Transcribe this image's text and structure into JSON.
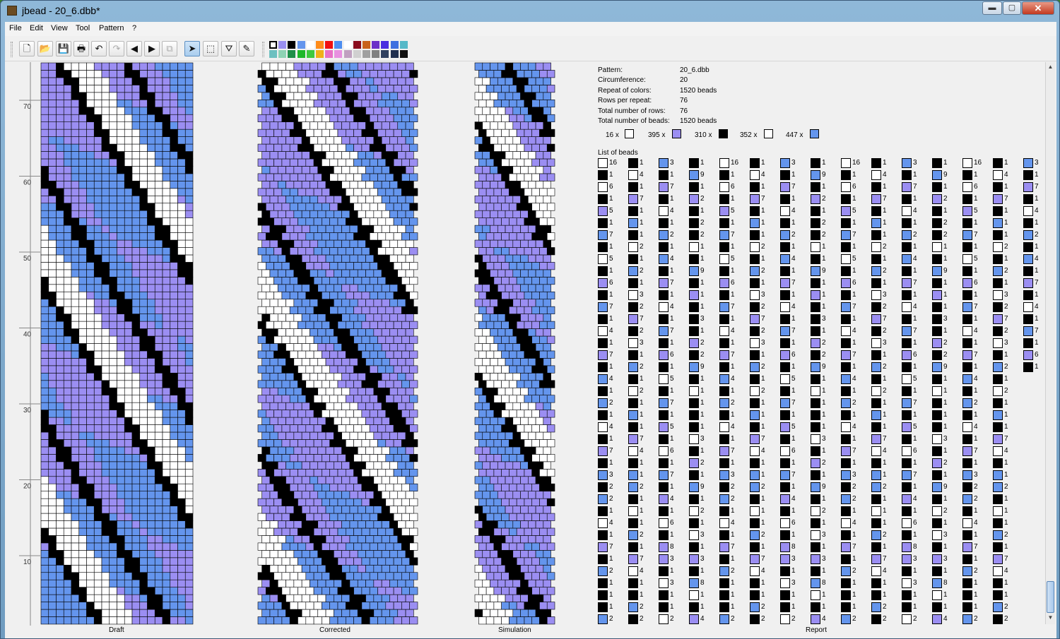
{
  "window": {
    "title": "jbead - 20_6.dbb*",
    "minimize": "▬",
    "maximize": "▢",
    "close": "✕"
  },
  "menu": [
    "File",
    "Edit",
    "View",
    "Tool",
    "Pattern",
    "?"
  ],
  "toolbar": [
    {
      "name": "new-icon",
      "glyph": "🗋"
    },
    {
      "name": "open-icon",
      "glyph": "📂"
    },
    {
      "name": "save-icon",
      "glyph": "💾"
    },
    {
      "name": "print-icon",
      "glyph": "🖶"
    },
    {
      "name": "undo-icon",
      "glyph": "↶"
    },
    {
      "name": "redo-icon",
      "glyph": "↷"
    },
    {
      "name": "shift-left-icon",
      "glyph": "◀"
    },
    {
      "name": "shift-right-icon",
      "glyph": "▶"
    },
    {
      "name": "copy-icon",
      "glyph": "⧉"
    },
    {
      "name": "pointer-tool-icon",
      "glyph": "➤"
    },
    {
      "name": "select-tool-icon",
      "glyph": "⬚"
    },
    {
      "name": "fill-tool-icon",
      "glyph": "⛛"
    },
    {
      "name": "picker-tool-icon",
      "glyph": "✎"
    }
  ],
  "palette": [
    "#ffffff",
    "#9a8ff0",
    "#000000",
    "#6495ed",
    "#ffffff",
    "#ff8c1a",
    "#f01010",
    "#4e8ef0",
    "#ffffff",
    "#8a0d1e",
    "#c8621c",
    "#6b2fc8",
    "#4a2ce0",
    "#3e6fe0",
    "#55b8c8",
    "#6dc0c0",
    "#8ed3b4",
    "#1f8f49",
    "#1fb82a",
    "#3fc93f",
    "#f0b01a",
    "#e870c8",
    "#e890e0",
    "#c0a0c0",
    "#d0d0d0",
    "#a0a0a0",
    "#808080",
    "#304060",
    "#203050",
    "#101010"
  ],
  "colors": {
    "white": "#ffffff",
    "lavender": "#9b8ef2",
    "black": "#000000",
    "blue": "#6495ed"
  },
  "ruler": [
    "70",
    "60",
    "50",
    "40",
    "30",
    "20",
    "10"
  ],
  "labels": {
    "draft": "Draft",
    "corrected": "Corrected",
    "simulation": "Simulation",
    "report": "Report"
  },
  "report": {
    "rows": [
      [
        "Pattern:",
        "20_6.dbb"
      ],
      [
        "Circumference:",
        "20"
      ],
      [
        "Repeat of colors:",
        "1520 beads"
      ],
      [
        "Rows per repeat:",
        "76"
      ],
      [
        "Total number of rows:",
        "76"
      ],
      [
        "Total number of beads:",
        "1520 beads"
      ]
    ],
    "counts": [
      {
        "n": "16 x",
        "c": "white"
      },
      {
        "n": "395 x",
        "c": "lavender"
      },
      {
        "n": "310 x",
        "c": "black"
      },
      {
        "n": "352 x",
        "c": "white"
      },
      {
        "n": "447 x",
        "c": "blue"
      }
    ],
    "list_title": "List of beads"
  },
  "bead_list": [
    [
      [
        "white",
        "16"
      ],
      [
        "black",
        "1"
      ],
      [
        "white",
        "6"
      ],
      [
        "black",
        "1"
      ],
      [
        "lavender",
        "5"
      ],
      [
        "black",
        "1"
      ],
      [
        "blue",
        "7"
      ],
      [
        "black",
        "1"
      ],
      [
        "white",
        "5"
      ],
      [
        "black",
        "1"
      ],
      [
        "lavender",
        "6"
      ],
      [
        "black",
        "1"
      ],
      [
        "blue",
        "7"
      ],
      [
        "black",
        "1"
      ],
      [
        "white",
        "4"
      ],
      [
        "black",
        "1"
      ],
      [
        "lavender",
        "7"
      ],
      [
        "black",
        "1"
      ],
      [
        "blue",
        "4"
      ],
      [
        "black",
        "1"
      ],
      [
        "blue",
        "2"
      ],
      [
        "black",
        "1"
      ],
      [
        "white",
        "4"
      ],
      [
        "black",
        "1"
      ],
      [
        "lavender",
        "7"
      ],
      [
        "black",
        "1"
      ],
      [
        "blue",
        "3"
      ],
      [
        "black",
        "2"
      ],
      [
        "blue",
        "2"
      ],
      [
        "black",
        "1"
      ],
      [
        "white",
        "4"
      ],
      [
        "black",
        "1"
      ],
      [
        "lavender",
        "7"
      ],
      [
        "black",
        "1"
      ],
      [
        "blue",
        "2"
      ],
      [
        "black",
        "1"
      ],
      [
        "black",
        "1"
      ],
      [
        "black",
        "1"
      ],
      [
        "blue",
        "2"
      ]
    ],
    [
      [
        "black",
        "1"
      ],
      [
        "white",
        "4"
      ],
      [
        "black",
        "1"
      ],
      [
        "lavender",
        "7"
      ],
      [
        "black",
        "1"
      ],
      [
        "blue",
        "1"
      ],
      [
        "black",
        "1"
      ],
      [
        "white",
        "2"
      ],
      [
        "black",
        "1"
      ],
      [
        "blue",
        "2"
      ],
      [
        "black",
        "1"
      ],
      [
        "white",
        "3"
      ],
      [
        "black",
        "2"
      ],
      [
        "lavender",
        "7"
      ],
      [
        "black",
        "2"
      ],
      [
        "white",
        "3"
      ],
      [
        "black",
        "1"
      ],
      [
        "blue",
        "2"
      ],
      [
        "black",
        "1"
      ],
      [
        "white",
        "2"
      ],
      [
        "black",
        "1"
      ],
      [
        "blue",
        "1"
      ],
      [
        "black",
        "1"
      ],
      [
        "lavender",
        "7"
      ],
      [
        "white",
        "4"
      ],
      [
        "black",
        "1"
      ],
      [
        "blue",
        "1"
      ],
      [
        "blue",
        "2"
      ],
      [
        "black",
        "1"
      ],
      [
        "white",
        "1"
      ],
      [
        "black",
        "1"
      ],
      [
        "blue",
        "2"
      ],
      [
        "black",
        "1"
      ],
      [
        "lavender",
        "7"
      ],
      [
        "white",
        "4"
      ],
      [
        "black",
        "1"
      ],
      [
        "black",
        "1"
      ],
      [
        "blue",
        "2"
      ],
      [
        "black",
        "2"
      ]
    ],
    [
      [
        "blue",
        "3"
      ],
      [
        "black",
        "1"
      ],
      [
        "lavender",
        "7"
      ],
      [
        "black",
        "1"
      ],
      [
        "white",
        "4"
      ],
      [
        "black",
        "1"
      ],
      [
        "blue",
        "2"
      ],
      [
        "black",
        "1"
      ],
      [
        "blue",
        "4"
      ],
      [
        "black",
        "1"
      ],
      [
        "lavender",
        "7"
      ],
      [
        "black",
        "1"
      ],
      [
        "white",
        "4"
      ],
      [
        "black",
        "1"
      ],
      [
        "blue",
        "7"
      ],
      [
        "black",
        "1"
      ],
      [
        "lavender",
        "6"
      ],
      [
        "black",
        "1"
      ],
      [
        "white",
        "5"
      ],
      [
        "black",
        "1"
      ],
      [
        "blue",
        "7"
      ],
      [
        "black",
        "1"
      ],
      [
        "lavender",
        "5"
      ],
      [
        "black",
        "1"
      ],
      [
        "white",
        "6"
      ],
      [
        "black",
        "1"
      ],
      [
        "blue",
        "7"
      ],
      [
        "black",
        "1"
      ],
      [
        "lavender",
        "4"
      ],
      [
        "black",
        "1"
      ],
      [
        "white",
        "6"
      ],
      [
        "black",
        "1"
      ],
      [
        "lavender",
        "8"
      ],
      [
        "lavender",
        "3"
      ],
      [
        "black",
        "1"
      ],
      [
        "white",
        "3"
      ],
      [
        "black",
        "1"
      ],
      [
        "black",
        "1"
      ],
      [
        "white",
        "2"
      ]
    ],
    [
      [
        "black",
        "1"
      ],
      [
        "blue",
        "9"
      ],
      [
        "black",
        "1"
      ],
      [
        "lavender",
        "2"
      ],
      [
        "black",
        "1"
      ],
      [
        "black",
        "2"
      ],
      [
        "black",
        "2"
      ],
      [
        "white",
        "1"
      ],
      [
        "black",
        "1"
      ],
      [
        "blue",
        "9"
      ],
      [
        "black",
        "1"
      ],
      [
        "lavender",
        "1"
      ],
      [
        "black",
        "1"
      ],
      [
        "black",
        "3"
      ],
      [
        "black",
        "1"
      ],
      [
        "lavender",
        "2"
      ],
      [
        "black",
        "2"
      ],
      [
        "blue",
        "9"
      ],
      [
        "black",
        "1"
      ],
      [
        "white",
        "1"
      ],
      [
        "black",
        "1"
      ],
      [
        "black",
        "1"
      ],
      [
        "black",
        "1"
      ],
      [
        "white",
        "3"
      ],
      [
        "black",
        "1"
      ],
      [
        "lavender",
        "2"
      ],
      [
        "black",
        "1"
      ],
      [
        "blue",
        "9"
      ],
      [
        "black",
        "1"
      ],
      [
        "white",
        "2"
      ],
      [
        "black",
        "1"
      ],
      [
        "white",
        "3"
      ],
      [
        "black",
        "1"
      ],
      [
        "lavender",
        "3"
      ],
      [
        "black",
        "1"
      ],
      [
        "blue",
        "8"
      ],
      [
        "white",
        "1"
      ],
      [
        "black",
        "1"
      ],
      [
        "lavender",
        "4"
      ]
    ]
  ]
}
